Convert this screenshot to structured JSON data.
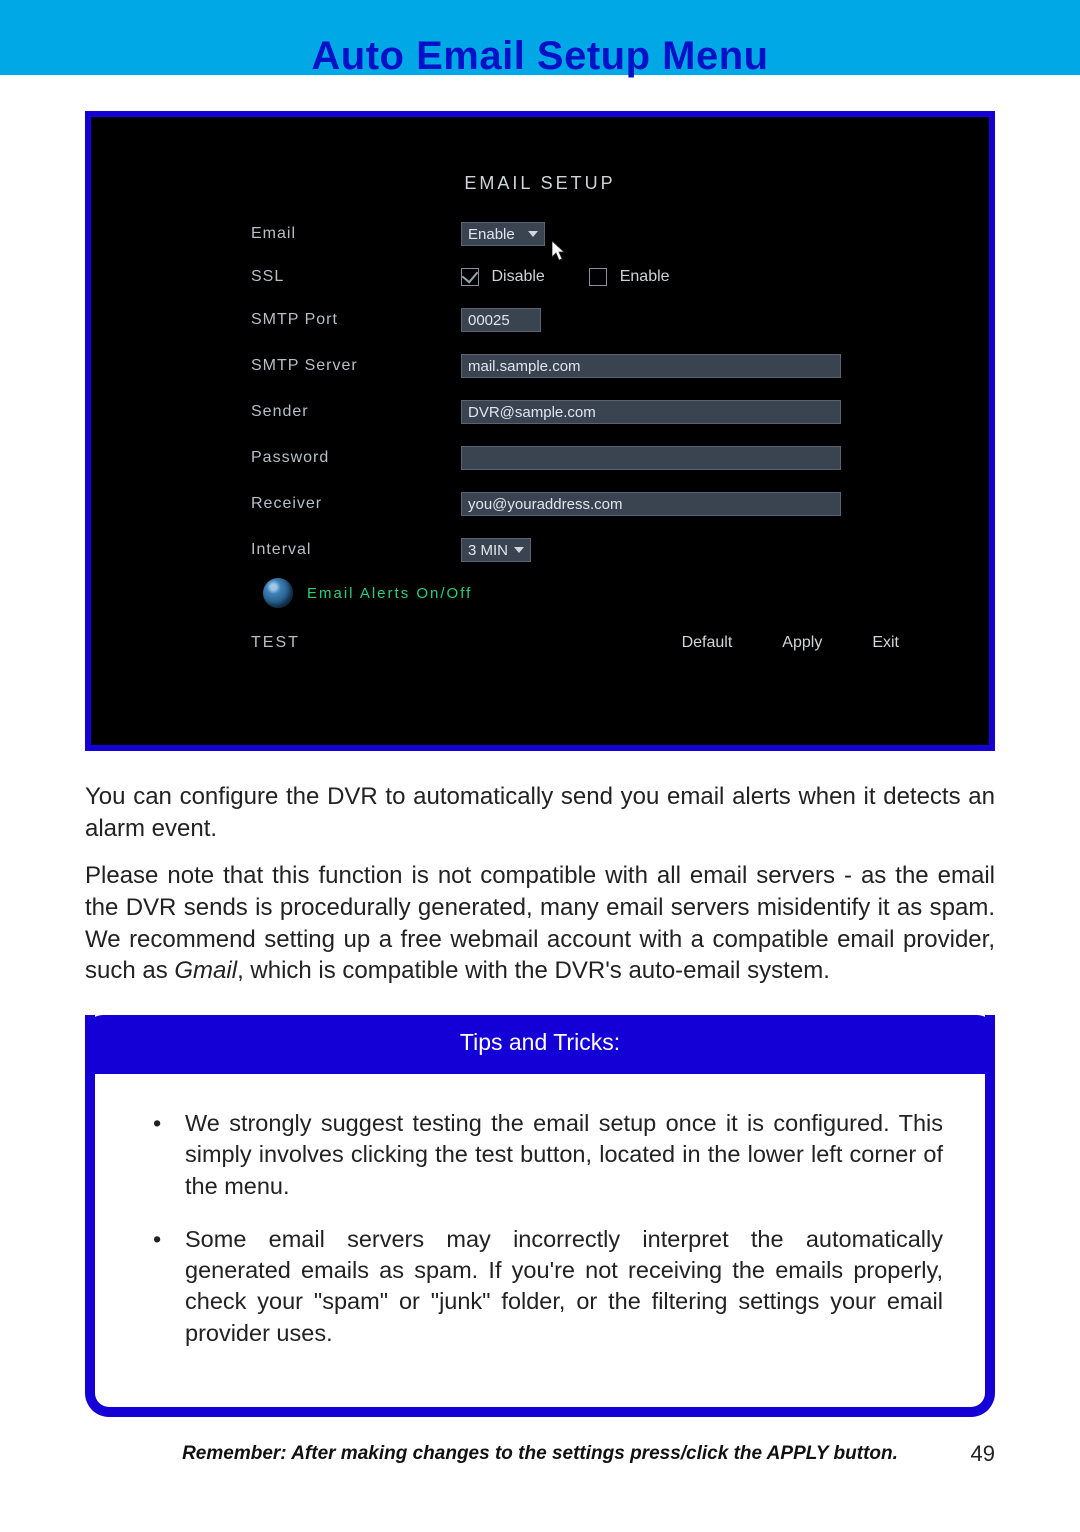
{
  "header": {
    "title": "Auto Email Setup Menu"
  },
  "screenshot": {
    "title": "EMAIL  SETUP",
    "labels": {
      "email": "Email",
      "ssl": "SSL",
      "smtp_port": "SMTP  Port",
      "smtp_server": "SMTP  Server",
      "sender": "Sender",
      "password": "Password",
      "receiver": "Receiver",
      "interval": "Interval",
      "test": "TEST"
    },
    "values": {
      "email_dropdown": "Enable",
      "ssl_disable": "Disable",
      "ssl_enable": "Enable",
      "smtp_port": "00025",
      "smtp_server": "mail.sample.com",
      "sender": "DVR@sample.com",
      "password": "",
      "receiver": "you@youraddress.com",
      "interval": "3 MIN"
    },
    "alerts_link": "Email  Alerts  On/Off",
    "buttons": {
      "default": "Default",
      "apply": "Apply",
      "exit": "Exit"
    }
  },
  "paragraphs": {
    "p1": "You can configure the DVR to automatically send you email alerts when it detects an alarm event.",
    "p2a": "Please note that this function is not compatible with all email servers - as the email the DVR sends is procedurally generated, many email servers misidentify it as spam. We recommend setting up a free webmail account with a compatible email provider, such as ",
    "p2em": "Gmail",
    "p2b": ", which is compatible with the DVR's auto-email system."
  },
  "tips": {
    "header": "Tips and Tricks:",
    "items": [
      "We strongly suggest testing the email setup once it is configured. This simply involves clicking the test button, located in the lower left corner of the menu.",
      "Some email servers may incorrectly interpret the automatically generated emails as spam. If you're not receiving the emails properly, check your \"spam\" or \"junk\" folder, or the filtering settings your email provider uses."
    ]
  },
  "footer": {
    "reminder": "Remember: After making changes to the settings press/click the APPLY button.",
    "page": "49"
  }
}
